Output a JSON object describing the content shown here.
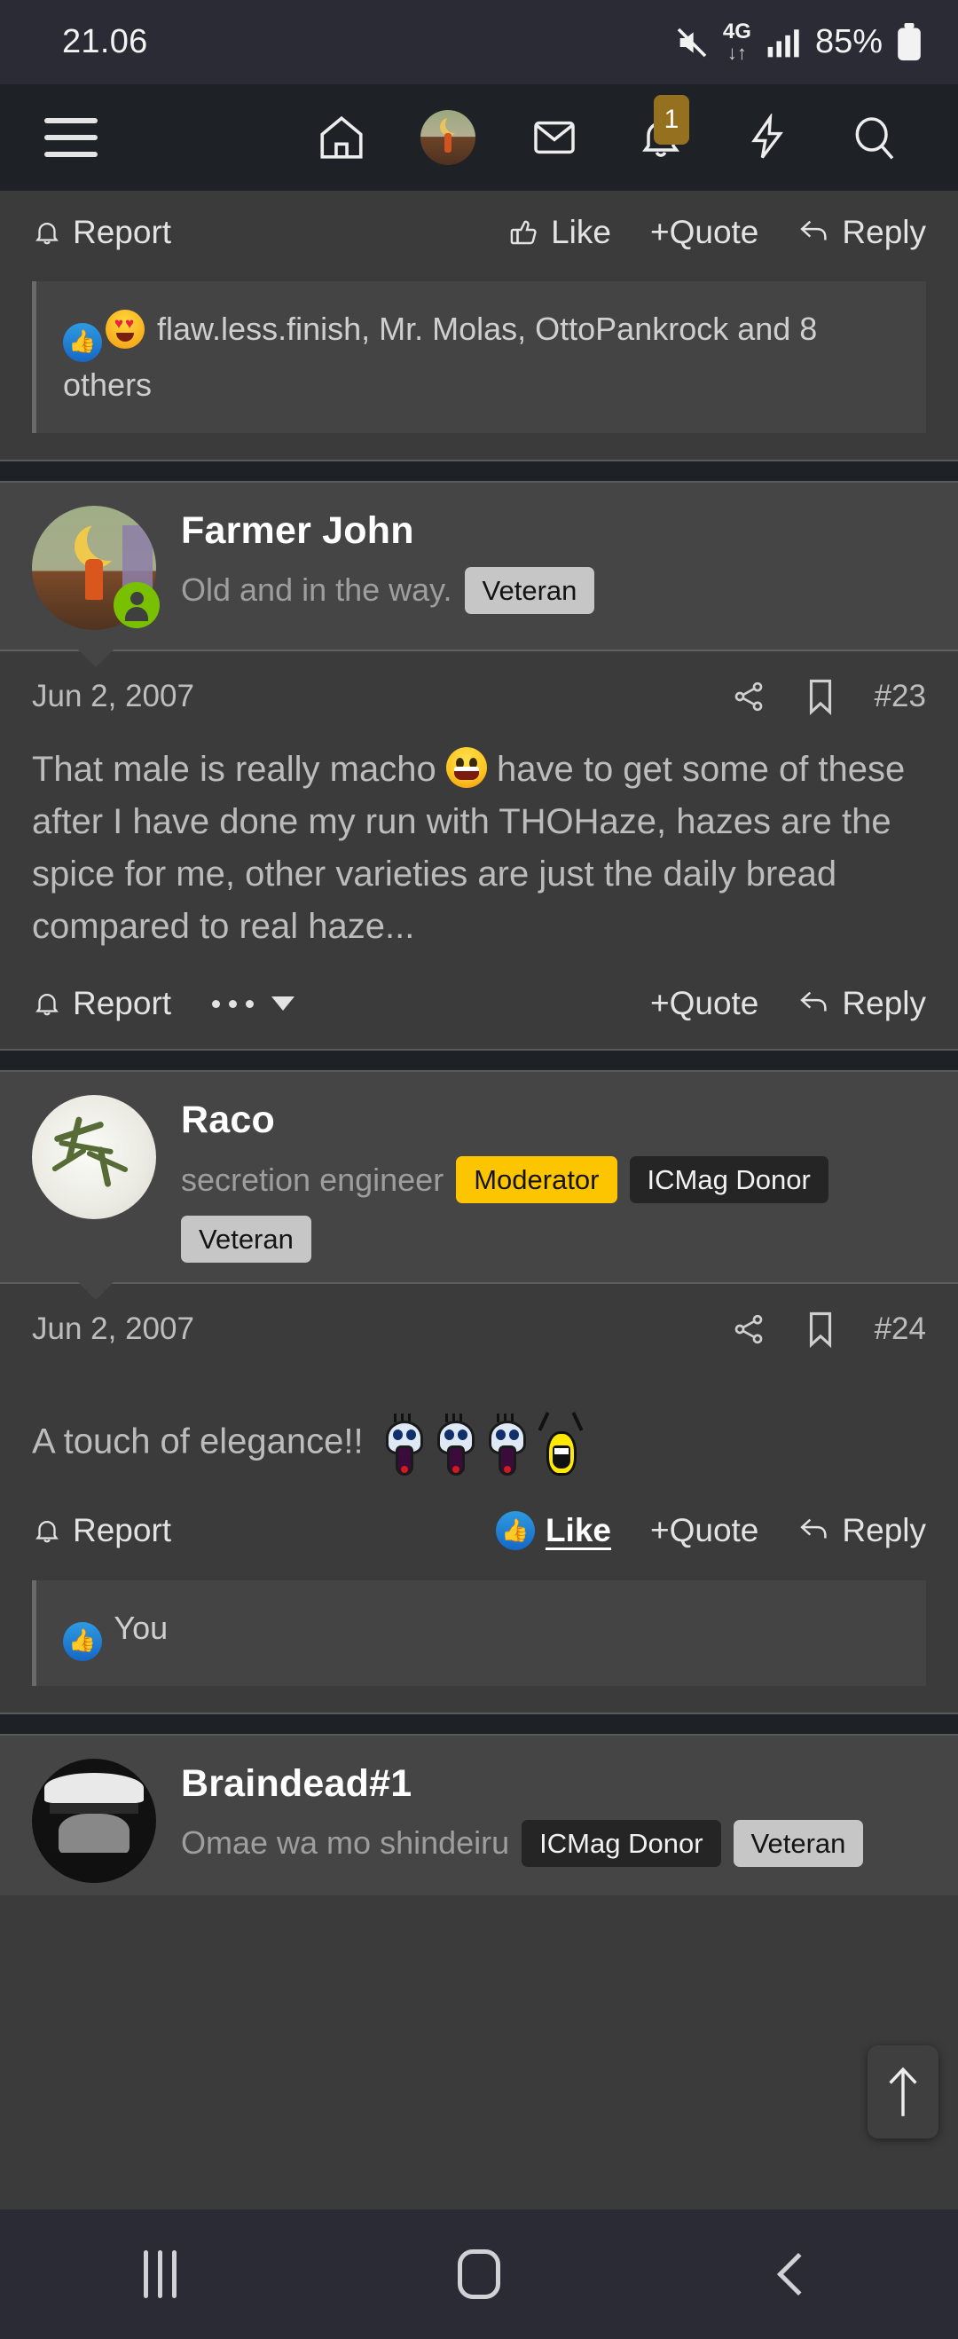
{
  "status_bar": {
    "time": "21.06",
    "battery_percent": "85%",
    "network_type": "4G",
    "icons": [
      "mute-icon",
      "data-transfer-icon",
      "signal-bars-icon",
      "battery-icon"
    ]
  },
  "app_nav": {
    "menu_icon": "hamburger-menu-icon",
    "items": [
      {
        "name": "home-icon",
        "label": "Home"
      },
      {
        "name": "account-avatar",
        "label": "Account"
      },
      {
        "name": "inbox-mail-icon",
        "label": "Inbox"
      },
      {
        "name": "notifications-bell-icon",
        "label": "Alerts",
        "badge": "1"
      },
      {
        "name": "whats-new-bolt-icon",
        "label": "What's new"
      },
      {
        "name": "search-icon",
        "label": "Search"
      }
    ]
  },
  "top_post_partial": {
    "actions": {
      "report": "Report",
      "like": "Like",
      "quote": "+Quote",
      "reply": "Reply"
    },
    "reactions_text": "flaw.less.finish, Mr. Molas, OttoPankrock and 8 others",
    "reaction_icons": [
      "thumbs-up-reaction",
      "heart-eyes-reaction"
    ]
  },
  "posts": [
    {
      "username": "Farmer John",
      "user_title": "Old and in the way.",
      "badges": [
        {
          "label": "Veteran",
          "style": "veteran"
        }
      ],
      "online": true,
      "date": "Jun 2, 2007",
      "post_number": "#23",
      "share_icon": "share-icon",
      "bookmark_icon": "bookmark-icon",
      "body_part1": "That male is really macho",
      "body_emoji": "grinning-face-emoji",
      "body_part2": "have to get some of these after I have done my run with THOHaze, hazes are the spice for me, other varieties are just the daily bread compared to real haze...",
      "actions": {
        "report": "Report",
        "more": "more-options",
        "quote": "+Quote",
        "reply": "Reply"
      },
      "liked": false,
      "reactions_text": null
    },
    {
      "username": "Raco",
      "user_title": "secretion engineer",
      "badges": [
        {
          "label": "Moderator",
          "style": "moderator"
        },
        {
          "label": "ICMag Donor",
          "style": "donor"
        },
        {
          "label": "Veteran",
          "style": "veteran"
        }
      ],
      "online": false,
      "date": "Jun 2, 2007",
      "post_number": "#24",
      "share_icon": "share-icon",
      "bookmark_icon": "bookmark-icon",
      "body_part1": "A touch of elegance!!",
      "body_emoji": "shocked-smilies",
      "body_part2": "",
      "actions": {
        "report": "Report",
        "like": "Like",
        "quote": "+Quote",
        "reply": "Reply"
      },
      "liked": true,
      "reactions_text": "You"
    },
    {
      "username": "Braindead#1",
      "user_title": "Omae wa mo shindeiru",
      "badges": [
        {
          "label": "ICMag Donor",
          "style": "donor"
        },
        {
          "label": "Veteran",
          "style": "veteran"
        }
      ],
      "online": false
    }
  ],
  "scroll_top_button": {
    "name": "scroll-to-top-arrow",
    "label": "↑"
  },
  "android_nav": {
    "recents": "recent-apps-button",
    "home": "home-button",
    "back": "back-button"
  },
  "colors": {
    "status_bg": "#2b2b35",
    "navbar_bg": "#1e2126",
    "post_head_bg": "#454545",
    "post_body_bg": "#3b3b3b",
    "separator_bg": "#1e2126",
    "moderator_badge": "#fdc400",
    "veteran_badge": "#c6c6c6",
    "donor_badge": "#252525",
    "like_blue": "#1668c7",
    "online_green": "#78c000",
    "badge_brown": "#94701f"
  }
}
